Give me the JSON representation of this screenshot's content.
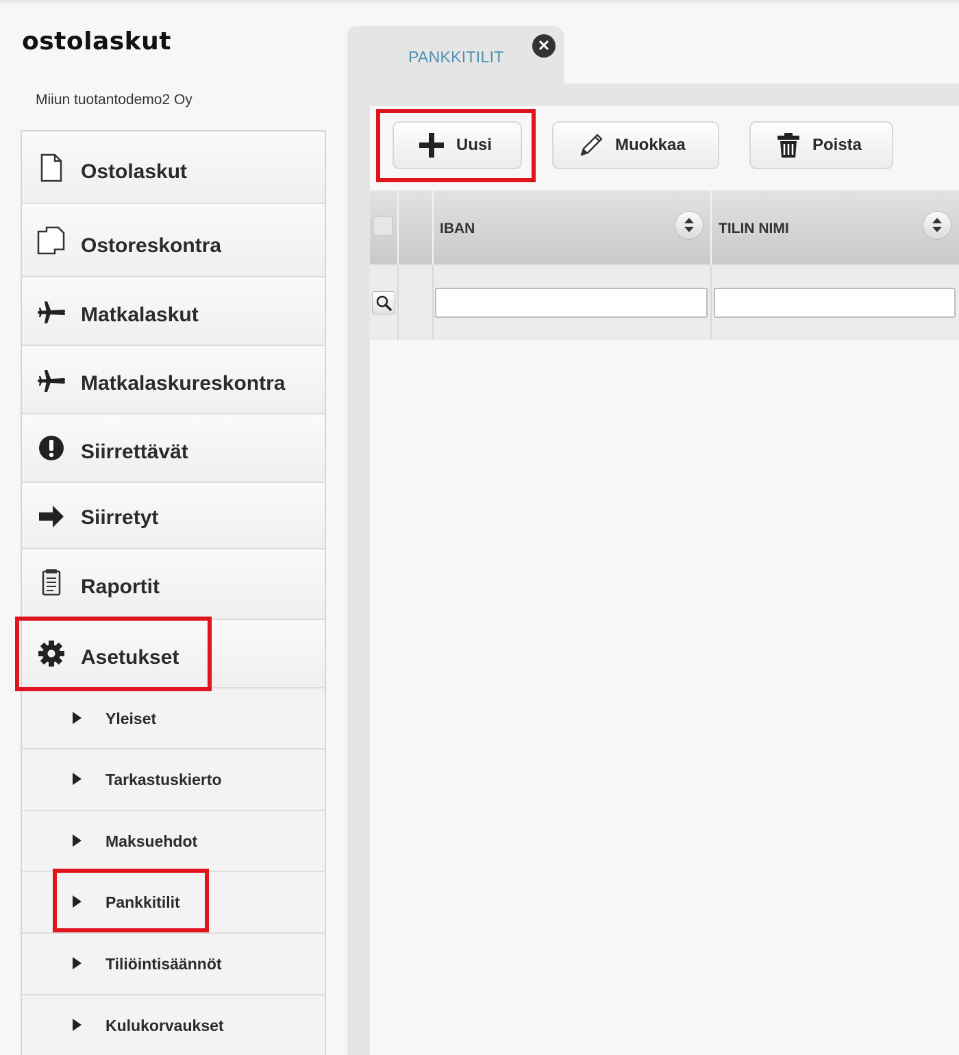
{
  "app": {
    "title": "ostolaskut",
    "company": "Miiun tuotantodemo2 Oy"
  },
  "sidebar": {
    "items": [
      {
        "label": "Ostolaskut",
        "icon": "document-icon"
      },
      {
        "label": "Ostoreskontra",
        "icon": "documents-icon"
      },
      {
        "label": "Matkalaskut",
        "icon": "airplane-icon"
      },
      {
        "label": "Matkalaskureskontra",
        "icon": "airplane-icon"
      },
      {
        "label": "Siirrettävät",
        "icon": "exclamation-icon"
      },
      {
        "label": "Siirretyt",
        "icon": "arrow-right-icon"
      },
      {
        "label": "Raportit",
        "icon": "report-icon"
      },
      {
        "label": "Asetukset",
        "icon": "gear-icon"
      }
    ],
    "subitems": [
      {
        "label": "Yleiset"
      },
      {
        "label": "Tarkastuskierto"
      },
      {
        "label": "Maksuehdot"
      },
      {
        "label": "Pankkitilit"
      },
      {
        "label": "Tiliöintisäännöt"
      },
      {
        "label": "Kulukorvaukset"
      }
    ]
  },
  "tab": {
    "label": "PANKKITILIT",
    "close_symbol": "✕"
  },
  "toolbar": {
    "new_label": "Uusi",
    "edit_label": "Muokkaa",
    "delete_label": "Poista"
  },
  "grid": {
    "columns": [
      "IBAN",
      "TILIN NIMI"
    ],
    "filter_values": [
      "",
      ""
    ]
  },
  "colors": {
    "highlight": "#e0141c",
    "tab_text": "#4f8fb2"
  }
}
